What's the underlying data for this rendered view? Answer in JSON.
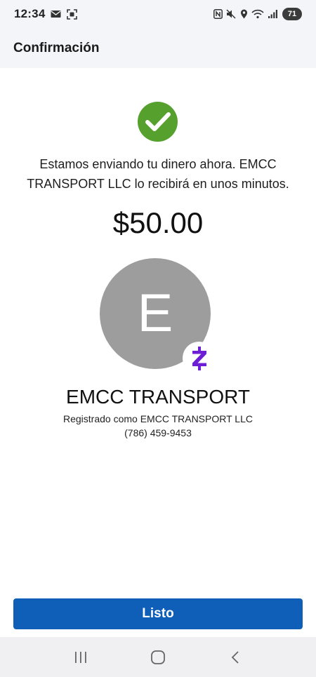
{
  "status_bar": {
    "time": "12:34",
    "battery": "71",
    "icons": [
      "mail-icon",
      "screenshot-icon",
      "nfc-icon",
      "mute-icon",
      "location-icon",
      "wifi-icon",
      "signal-icon"
    ]
  },
  "header": {
    "title": "Confirmación"
  },
  "confirmation": {
    "message": "Estamos enviando tu dinero ahora. EMCC TRANSPORT LLC lo recibirá en unos minutos.",
    "amount": "$50.00",
    "success_color": "#56a12e"
  },
  "recipient": {
    "initial": "E",
    "name": "EMCC TRANSPORT",
    "registered_as": "Registrado como EMCC TRANSPORT LLC",
    "phone": "(786) 459-9453",
    "avatar_color": "#9d9d9d",
    "badge_icon": "zelle-icon",
    "badge_color": "#6d1ed4"
  },
  "actions": {
    "done_label": "Listo",
    "accent": "#0f5fb8"
  },
  "nav": {
    "icons": [
      "recent-apps-icon",
      "home-icon",
      "back-icon"
    ]
  }
}
